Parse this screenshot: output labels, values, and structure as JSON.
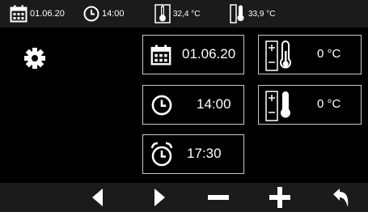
{
  "status_bar": {
    "date": "01.06.20",
    "time": "14:00",
    "temp_inside": "32,4 °C",
    "temp_outside": "33,9 °C",
    "icons": [
      "calendar-icon",
      "clock-icon",
      "thermometer-icon",
      "outdoor-thermometer-icon"
    ]
  },
  "main": {
    "settings_icon": "gear-icon",
    "date_setting": {
      "value": "01.06.20",
      "icon": "calendar-icon"
    },
    "time_setting": {
      "value": "14:00",
      "icon": "clock-icon"
    },
    "alarm_setting": {
      "value": "17:30",
      "icon": "alarm-clock-icon"
    },
    "temp_offset_1": {
      "value": "0 °C",
      "icon": "thermometer-plus-minus-icon"
    },
    "temp_offset_2": {
      "value": "0 °C",
      "icon": "thermometer-plus-minus-icon"
    }
  },
  "bottom_bar": {
    "buttons": [
      "triangle-left-icon",
      "triangle-right-icon",
      "minus-icon",
      "plus-icon",
      "return-arrow-icon"
    ]
  },
  "colors": {
    "background": "#000000",
    "bar": "#1b1b1b",
    "border": "#c8c8c8",
    "text": "#ffffff"
  }
}
